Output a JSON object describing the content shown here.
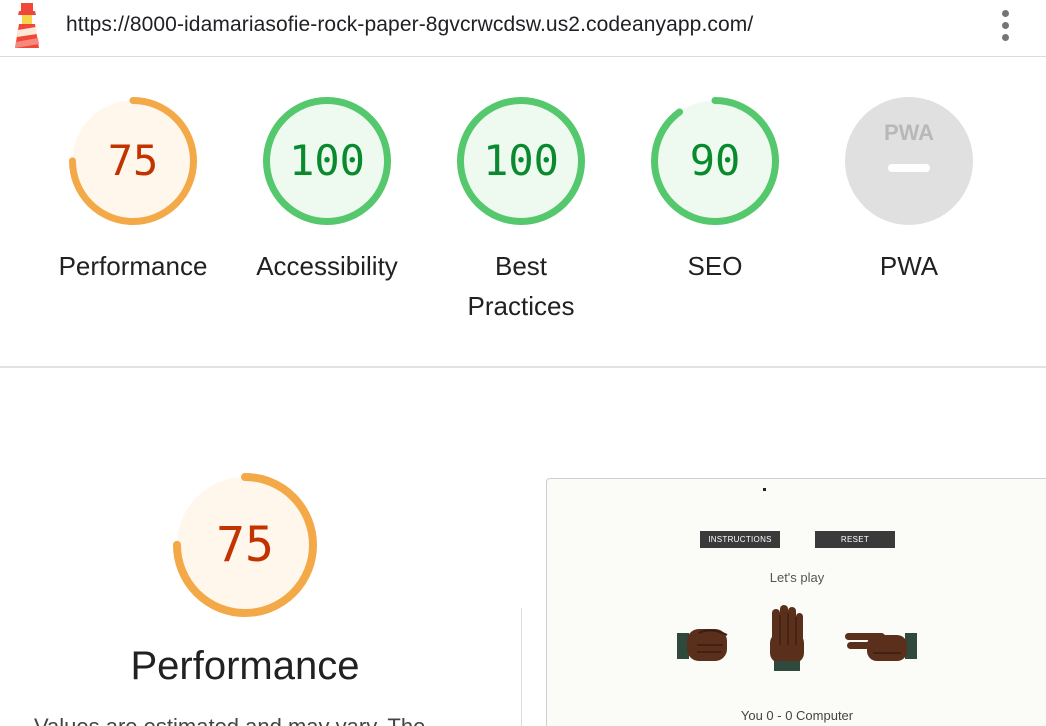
{
  "browser": {
    "url": "https://8000-idamariasofie-rock-paper-8gvcrwcdsw.us2.codeanyapp.com/"
  },
  "scores": [
    {
      "label": "Performance",
      "value": "75",
      "fraction": 0.75,
      "color": "#f3a947",
      "fill": "#fff6ec"
    },
    {
      "label": "Accessibility",
      "value": "100",
      "fraction": 1.0,
      "color": "#55c76c",
      "fill": "#eefaf0"
    },
    {
      "label": "Best Practices",
      "value": "100",
      "fraction": 1.0,
      "color": "#55c76c",
      "fill": "#eefaf0"
    },
    {
      "label": "SEO",
      "value": "90",
      "fraction": 0.9,
      "color": "#55c76c",
      "fill": "#eefaf0"
    },
    {
      "label": "PWA",
      "value": "",
      "fraction": 0,
      "color": "#d9d9d9",
      "fill": "#e0e0e0"
    }
  ],
  "pwa_badge": "PWA",
  "detail": {
    "score": "75",
    "fraction": 0.75,
    "title": "Performance",
    "description_fragment": "Values are estimated and may vary. The"
  },
  "thumbnail": {
    "instructions_button": "INSTRUCTIONS",
    "reset_button": "RESET",
    "prompt": "Let's play",
    "score_line": "You 0 - 0 Computer"
  },
  "colors": {
    "orange": "#f3a947",
    "green": "#55c76c",
    "gray": "#d9d9d9"
  }
}
